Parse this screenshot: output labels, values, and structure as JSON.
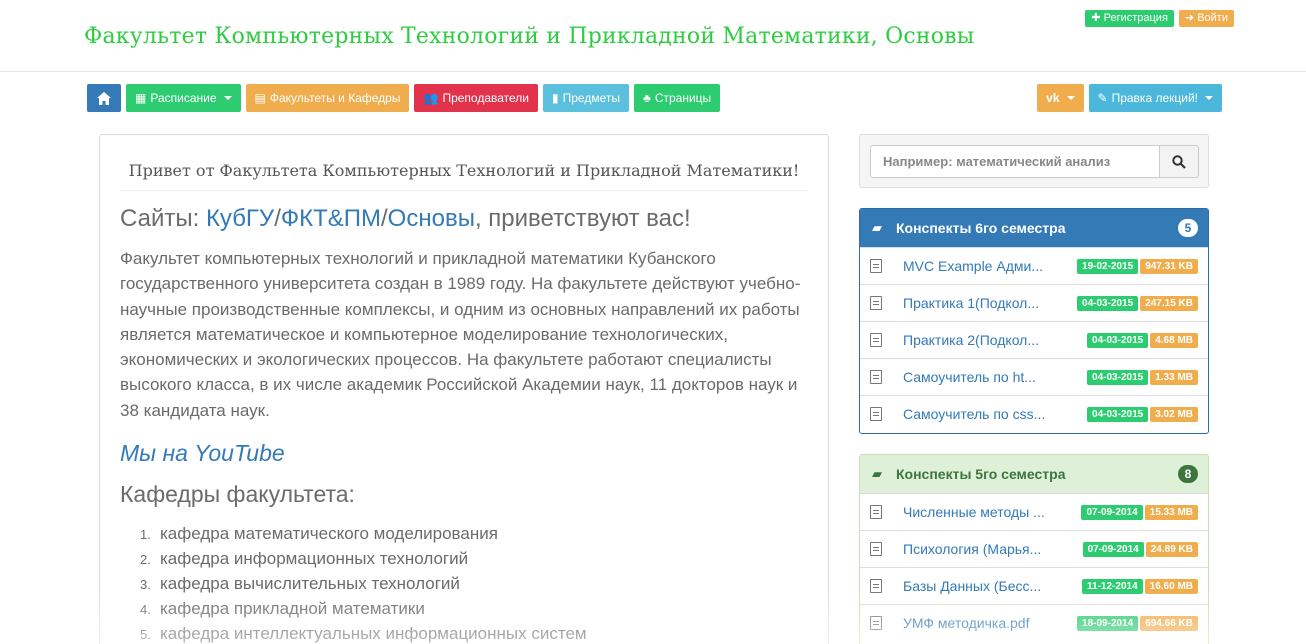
{
  "header": {
    "brand": "Факультет Компьютерных Технологий и Прикладной Математики, Основы",
    "register_label": "Регистрация",
    "login_label": "Войти"
  },
  "nav": {
    "schedule_label": "Расписание",
    "faculties_label": "Факультеты и Кафедры",
    "teachers_label": "Преподаватели",
    "subjects_label": "Предметы",
    "pages_label": "Страницы",
    "vk_label": "vk",
    "lectures_label": "Правка лекций!"
  },
  "main": {
    "greeting": "Привет от Факультета Компьютерных Технологий и Прикладной Математики!",
    "sites_prefix": "Сайты: ",
    "site1": "КубГУ",
    "sep1": "/",
    "site2": "ФКТ&ПМ",
    "sep2": "/",
    "site3": "Основы",
    "sites_suffix": ", приветствуют вас!",
    "intro": "Факультет компьютерных технологий и прикладной математики Кубанского государственного университета создан в 1989 году. На факультете действуют учебно-научные производственные комплексы, и одним из основных направлений их работы является математическое и компьютерное моделирование технологических, экономических и экологических процессов. На факультете работают специалисты высокого класса, в их числе академик Российской Академии наук, 11 докторов наук и 38 кандидата наук.",
    "youtube": "Мы на YouTube",
    "departments_title": "Кафедры факультета:",
    "departments": [
      {
        "num": "1.",
        "label": "кафедра математического моделирования"
      },
      {
        "num": "2.",
        "label": "кафедра информационных технологий"
      },
      {
        "num": "3.",
        "label": "кафедра вычислительных технологий"
      },
      {
        "num": "4.",
        "label": "кафедра прикладной математики"
      },
      {
        "num": "5.",
        "label": "кафедра интеллектуальных информационных систем"
      }
    ]
  },
  "search": {
    "placeholder": "Например: математический анализ"
  },
  "sem6": {
    "title": "Конспекты 6го семестра",
    "count": "5",
    "items": [
      {
        "name": "MVC Example Адми...",
        "date": "19-02-2015",
        "size": "947.31 KB"
      },
      {
        "name": "Практика 1(Подкол...",
        "date": "04-03-2015",
        "size": "247.15 KB"
      },
      {
        "name": "Практика 2(Подкол...",
        "date": "04-03-2015",
        "size": "4.68 MB"
      },
      {
        "name": "Самоучитель по ht...",
        "date": "04-03-2015",
        "size": "1.33 MB"
      },
      {
        "name": "Самоучитель по css...",
        "date": "04-03-2015",
        "size": "3.02 MB"
      }
    ]
  },
  "sem5": {
    "title": "Конспекты 5го семестра",
    "count": "8",
    "items": [
      {
        "name": "Численные методы ...",
        "date": "07-09-2014",
        "size": "15.33 MB"
      },
      {
        "name": "Психология (Марья...",
        "date": "07-09-2014",
        "size": "24.89 KB"
      },
      {
        "name": "Базы Данных (Бесс...",
        "date": "11-12-2014",
        "size": "16.60 MB"
      },
      {
        "name": "УМФ методичка.pdf",
        "date": "18-09-2014",
        "size": "694.66 KB"
      }
    ]
  }
}
